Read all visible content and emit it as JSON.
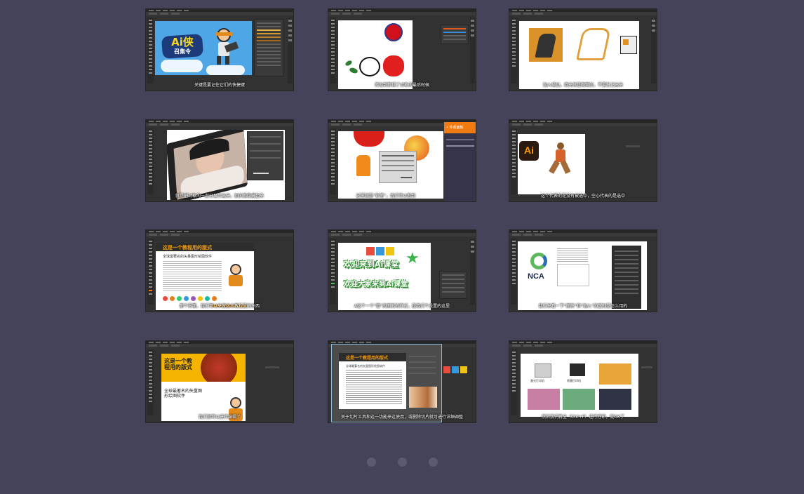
{
  "thumbnails": [
    {
      "subtitle": "关键是要记住它们的快捷键",
      "art_title": "Ai侠",
      "art_subtitle": "召集令"
    },
    {
      "subtitle": "添加到剪辑了对象的最后时候"
    },
    {
      "subtitle": "加入描边，填充就是图案的，不要忘记出来"
    },
    {
      "subtitle": "就是把对象的一部分显示出来，别的都隐藏起来"
    },
    {
      "subtitle": "这里就是“彩笔”，我们可以看到",
      "panel_header": "• 外观面板"
    },
    {
      "subtitle": "这个代表的是没有被选中，空心代表的是选中",
      "logo": "Ai"
    },
    {
      "subtitle": "那个界面，我们可以来做这本教程里的东西",
      "art_title": "这是一个教程用的版式",
      "art_heading": "全球最著名的矢量图形绘图软件"
    },
    {
      "subtitle": "A这个一个“管”的图形的样式，是我们个设置的这里",
      "art_line1": "欢迎来到Ai课堂",
      "art_line2": "欢迎大家来到Ai课堂"
    },
    {
      "subtitle": "我们来看一下“图形”和“加入”的区别是怎么用的",
      "logo": "NCA"
    },
    {
      "subtitle": "我们就可以进行编辑了",
      "art_title": "这是一个教程用的版式",
      "art_heading": "全球最著名的矢量图形绘图软件"
    },
    {
      "subtitle": "关于切片工具和这一功能来这使用，或删除切片就可进行详细调整",
      "art_title": "这是一个教程用的版式",
      "art_heading": "全球最著名的矢量图形绘图软件"
    },
    {
      "subtitle": "然后我们再全（Ctrl+P）进行打印，就OK了",
      "label1": "激光打印机",
      "label2": "喷墨打印机"
    }
  ],
  "pagination": {
    "count": 3,
    "active_index": 0
  },
  "colors": {
    "background": "#44435a",
    "dot": "#5b5a70",
    "accent_orange": "#f07b12"
  }
}
